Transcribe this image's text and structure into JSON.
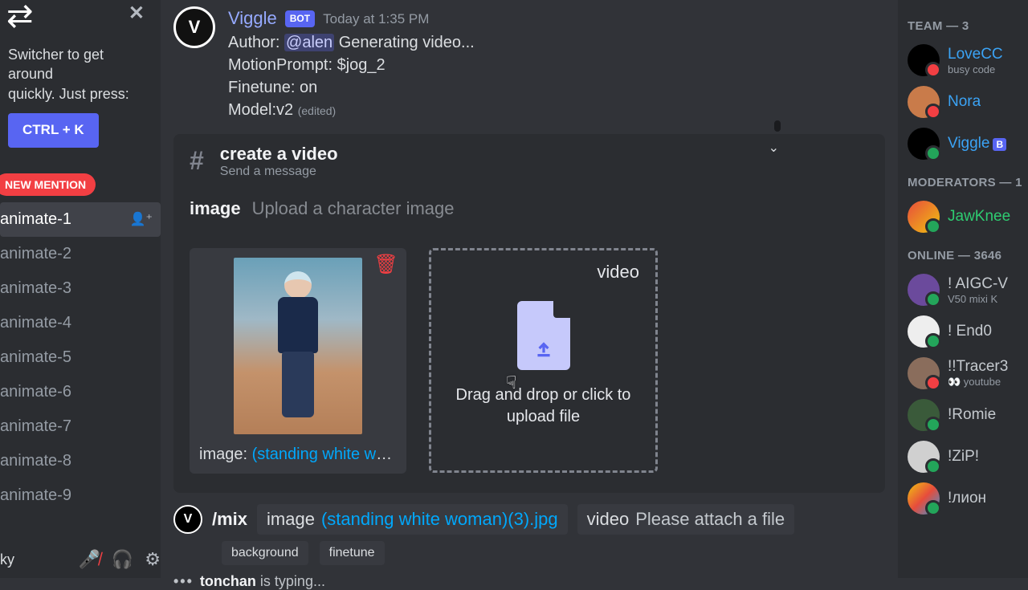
{
  "sidebar": {
    "hint_line1": "Switcher to get around",
    "hint_line2": "quickly. Just press:",
    "kbd": "CTRL + K",
    "new_mention": "NEW MENTION",
    "channels": [
      "animate-1",
      "animate-2",
      "animate-3",
      "animate-4",
      "animate-5",
      "animate-6",
      "animate-7",
      "animate-8",
      "animate-9"
    ],
    "extra_channel": "ky"
  },
  "message": {
    "sender": "Viggle",
    "bot": "BOT",
    "time": "Today at 1:35 PM",
    "line1_prefix": "Author: ",
    "mention": "@alen",
    "line1_suffix": " Generating video...",
    "line2": "MotionPrompt: $jog_2",
    "line3": "Finetune: on",
    "line4": "Model:v2",
    "edited": "(edited)"
  },
  "thread": {
    "title": "create a video",
    "sub": "Send a message"
  },
  "param": {
    "label": "image",
    "hint": "Upload a character image"
  },
  "thumb": {
    "caption_prefix": "image: ",
    "caption_link": "(standing white wom…"
  },
  "dropzone": {
    "label": "video",
    "text": "Drag and drop or click to upload file"
  },
  "command": {
    "cmd": "/mix",
    "p1": {
      "k": "image",
      "v": "(standing white woman)(3).jpg"
    },
    "p2": {
      "k": "video",
      "v": "Please attach a file"
    },
    "p3": "background",
    "p4": "finetune"
  },
  "typing": {
    "user": "tonchan",
    "suffix": "is typing..."
  },
  "members": {
    "g1": "TEAM — 3",
    "team": [
      {
        "name": "LoveCC",
        "sub": "busy code"
      },
      {
        "name": "Nora"
      },
      {
        "name": "Viggle",
        "bot": true
      }
    ],
    "g2": "MODERATORS — 1",
    "mods": [
      {
        "name": "JawKnee"
      }
    ],
    "g3": "ONLINE — 3646",
    "online": [
      {
        "name": "! AIGC-V",
        "sub": "V50 mixi K"
      },
      {
        "name": "! End0"
      },
      {
        "name": "!!Tracer3",
        "sub": "👀 youtube"
      },
      {
        "name": "!Romie"
      },
      {
        "name": "!ZiP!"
      },
      {
        "name": "!лион"
      }
    ]
  }
}
